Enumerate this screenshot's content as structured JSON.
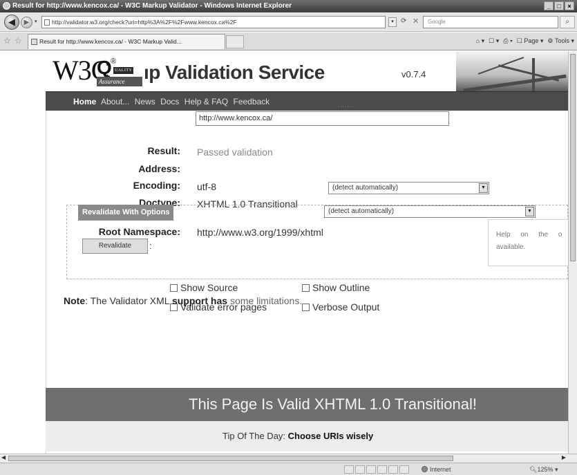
{
  "browser": {
    "window_title": "Result for http://www.kencox.ca/ - W3C Markup Validator - Windows Internet Explorer",
    "window_buttons": [
      "_",
      "□",
      "×"
    ],
    "address_url": "http://validator.w3.org/check?uri=http%3A%2F%2Fwww.kencox.ca%2F",
    "search_placeholder": "Google",
    "tab_title": "Result for http://www.kencox.ca/ - W3C Markup Valid...",
    "commands": {
      "page": "Page",
      "tools": "Tools"
    },
    "status_zone": "Internet",
    "zoom": "125%"
  },
  "header": {
    "logo": "W3C",
    "logo_reg": "®",
    "qa_letter": "Q",
    "qa_quality": "UALITY",
    "qa_assurance": "Assurance",
    "title": "ıp Validation Service",
    "version": "v0.7.4"
  },
  "nav": {
    "home": "Home",
    "about": "About...",
    "news": "News",
    "docs": "Docs",
    "help": "Help & FAQ",
    "feedback": "Feedback"
  },
  "result": {
    "result_label": "Result:",
    "result_value": "Passed validation",
    "address_label": "Address:",
    "address_value": "http://www.kencox.ca/",
    "encoding_label": "Encoding:",
    "encoding_value": "utf-8",
    "encoding_select": "(detect automatically)",
    "doctype_label": "Doctype:",
    "doctype_value": "XHTML 1.0 Transitional",
    "doctype_select": "(detect automatically)",
    "namespace_label": "Root Namespace:",
    "namespace_value": "http://www.w3.org/1999/xhtml"
  },
  "revalidate": {
    "legend": "Revalidate With Options",
    "button": "Revalidate",
    "colon": ":",
    "show_source": "Show Source",
    "show_outline": "Show Outline",
    "validate_error_pages": "Validate error pages",
    "verbose_output": "Verbose Output",
    "help_text_line1": "Help on the o",
    "help_text_line2": "available."
  },
  "note": {
    "label": "Note",
    "text_a": ": The Validator XML ",
    "support": "support",
    "has": " has ",
    "text_b": "some limitations."
  },
  "banner": {
    "valid": "This Page Is Valid XHTML 1.0 Transitional!",
    "tip_prefix": "Tip Of The Day: ",
    "tip": "Choose URIs wisely"
  }
}
